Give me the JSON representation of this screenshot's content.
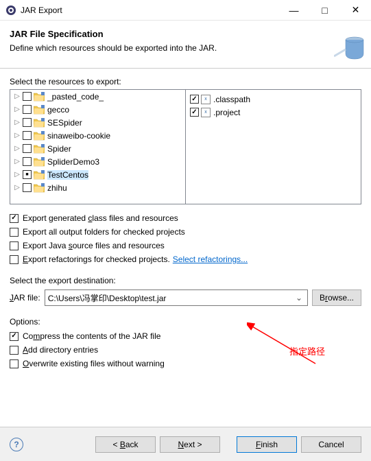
{
  "titlebar": {
    "title": "JAR Export"
  },
  "header": {
    "title": "JAR File Specification",
    "subtitle": "Define which resources should be exported into the JAR."
  },
  "resources": {
    "label": "Select the resources to export:",
    "projects": [
      {
        "name": "_pasted_code_",
        "checked": false
      },
      {
        "name": "gecco",
        "checked": false
      },
      {
        "name": "SESpider",
        "checked": false
      },
      {
        "name": "sinaweibo-cookie",
        "checked": false
      },
      {
        "name": "Spider",
        "checked": false
      },
      {
        "name": "SpliderDemo3",
        "checked": false
      },
      {
        "name": "TestCentos",
        "checked": "square",
        "selected": true
      },
      {
        "name": "zhihu",
        "checked": false
      }
    ],
    "files": [
      {
        "name": ".classpath",
        "checked": true
      },
      {
        "name": ".project",
        "checked": true
      }
    ]
  },
  "export_options": {
    "generated": {
      "label": "Export generated class files and resources",
      "checked": true
    },
    "output_folders": {
      "label": "Export all output folders for checked projects",
      "checked": false
    },
    "java_source": {
      "label": "Export Java source files and resources",
      "checked": false
    },
    "refactorings": {
      "label": "Export refactorings for checked projects.",
      "checked": false,
      "link": "Select refactorings..."
    }
  },
  "destination": {
    "label": "Select the export destination:",
    "field_label": "JAR file:",
    "value": "C:\\Users\\冯掌印\\Desktop\\test.jar",
    "browse": "Browse..."
  },
  "options": {
    "label": "Options:",
    "compress": {
      "label": "Compress the contents of the JAR file",
      "checked": true
    },
    "add_dir": {
      "label": "Add directory entries",
      "checked": false
    },
    "overwrite": {
      "label": "Overwrite existing files without warning",
      "checked": false
    }
  },
  "footer": {
    "back": "< Back",
    "next": "Next >",
    "finish": "Finish",
    "cancel": "Cancel"
  },
  "annotation": {
    "text": "指定路径"
  }
}
